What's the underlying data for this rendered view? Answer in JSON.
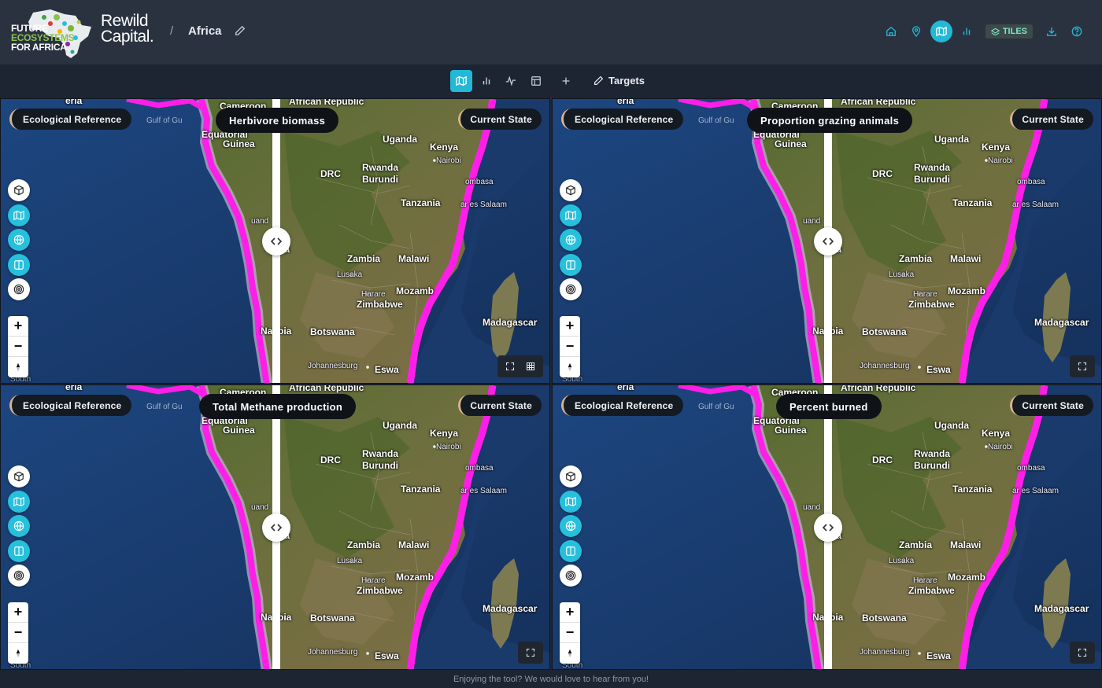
{
  "header": {
    "logo_lines": [
      "FUTURE",
      "ECOSYSTEMS",
      "FOR AFRICA"
    ],
    "brand_line1": "Rewild",
    "brand_line2": "Capital.",
    "separator": "/",
    "project_title": "Africa",
    "tiles_label": "TILES",
    "icons": [
      "home-icon",
      "map-pin-icon",
      "map-icon",
      "bar-chart-icon",
      "layers-icon",
      "download-icon",
      "help-icon"
    ],
    "active_icon": "map-icon"
  },
  "toolbar": {
    "icons": [
      "map-icon",
      "bar-chart-icon",
      "line-chart-icon",
      "table-icon",
      "plus-icon"
    ],
    "active_icon": "map-icon",
    "targets_label": "Targets"
  },
  "panels": [
    {
      "metric": "Herbivore biomass",
      "left_label": "Ecological Reference",
      "right_label": "Current State"
    },
    {
      "metric": "Proportion grazing animals",
      "left_label": "Ecological Reference",
      "right_label": "Current State"
    },
    {
      "metric": "Total Methane production",
      "left_label": "Ecological Reference",
      "right_label": "Current State"
    },
    {
      "metric": "Percent burned",
      "left_label": "Ecological Reference",
      "right_label": "Current State"
    }
  ],
  "map_labels": {
    "cameroon": "Cameroon",
    "african_republic": "African Republic",
    "gulf": "Gulf of Gu",
    "equatorial": "Equatorial",
    "guinea": "Guinea",
    "uganda": "Uganda",
    "kenya": "Kenya",
    "nairobi": "Nairobi",
    "drc": "DRC",
    "rwanda": "Rwanda",
    "burundi": "Burundi",
    "mombasa": "ombasa",
    "tanzania": "Tanzania",
    "dar": "ar es Salaam",
    "angola": "la",
    "luanda": "uand",
    "zambia": "Zambia",
    "malawi": "Malawi",
    "lusaka": "Lusaka",
    "harare": "Harare",
    "zimbabwe": "Zimbabwe",
    "mozambique": "Mozamb",
    "madagascar": "Madagascar",
    "namibia": "Na  ibia",
    "botswana": "Botswana",
    "johannesburg": "Johannesburg",
    "eswatini": "Eswa",
    "south": "South",
    "top_fragment": "eria"
  },
  "footer": {
    "text": "Enjoying the tool? We would love to hear from you!"
  },
  "colors": {
    "accent": "#23b9d6",
    "highlight": "#ff1ee8",
    "ocean": "#1a3a6b",
    "land": "#5d6b3c"
  }
}
